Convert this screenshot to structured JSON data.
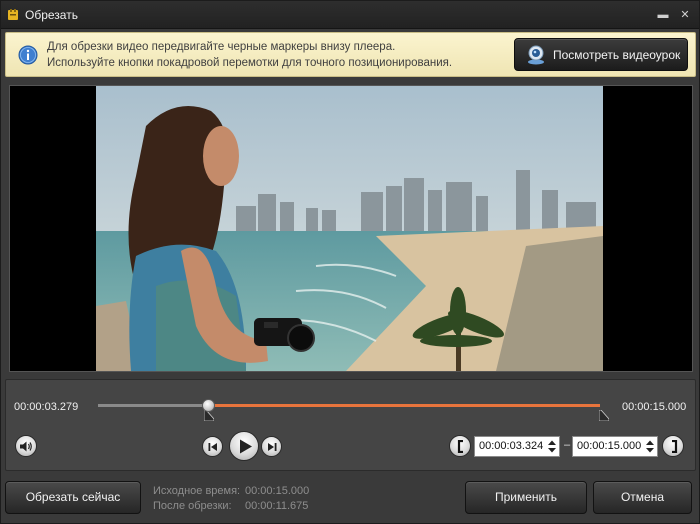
{
  "window": {
    "title": "Обрезать",
    "minimize": "▬",
    "close": "✕"
  },
  "info": {
    "line1": "Для обрезки видео передвигайте черные маркеры внизу плеера.",
    "line2": "Используйте кнопки покадровой перемотки для точного позиционирования.",
    "tutorial_button": "Посмотреть видеоурок"
  },
  "timeline": {
    "current_time": "00:00:03.279",
    "total_time": "00:00:15.000",
    "playhead_fraction": 0.2186,
    "selection_start_fraction": 0.2216,
    "selection_end_fraction": 1.0
  },
  "trim": {
    "start_value": "00:00:03.324",
    "end_value": "00:00:15.000",
    "separator": "–"
  },
  "footer": {
    "trim_now_button": "Обрезать сейчас",
    "original_label": "Исходное время:",
    "original_value": "00:00:15.000",
    "after_label": "После обрезки:",
    "after_value": "00:00:11.675",
    "apply_button": "Применить",
    "cancel_button": "Отмена"
  },
  "colors": {
    "accent": "#e8743c",
    "info_bg": "#fbf4cf",
    "panel": "#454545"
  },
  "icons": {
    "app": "scissors-film-icon",
    "info": "info-icon",
    "tutorial": "webcam-icon",
    "volume": "speaker-icon",
    "prev_frame": "step-back-icon",
    "play": "play-icon",
    "next_frame": "step-forward-icon",
    "mark_in": "bracket-left-icon",
    "mark_out": "bracket-right-icon"
  }
}
